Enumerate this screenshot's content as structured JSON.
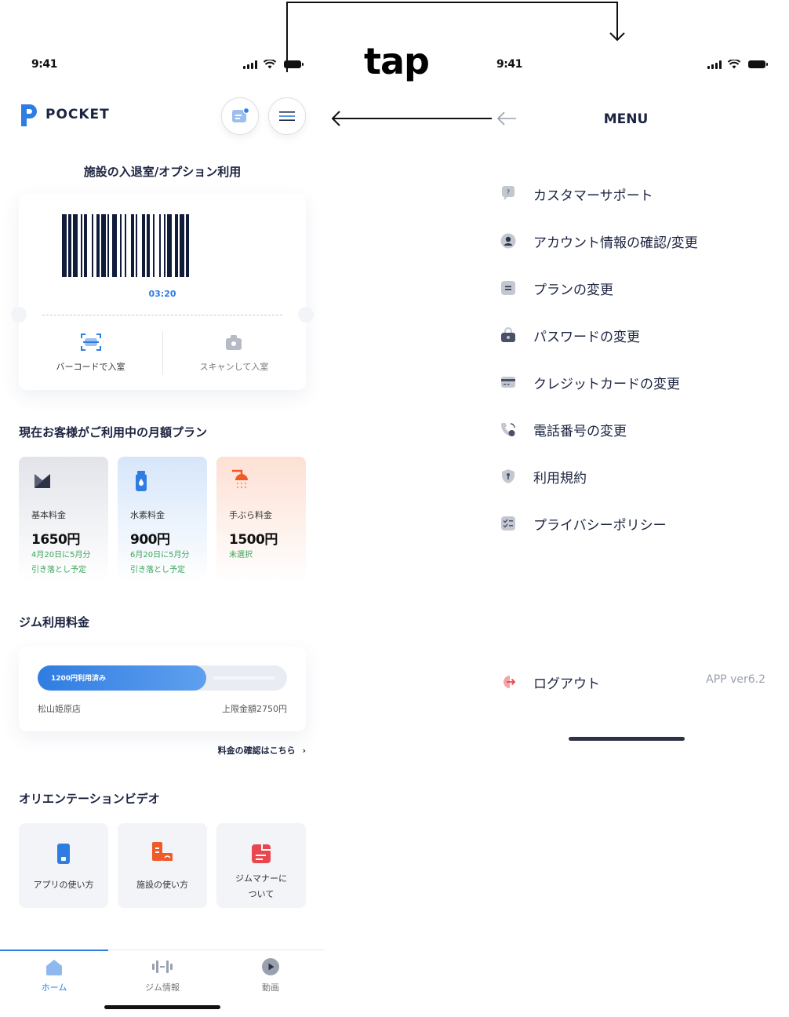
{
  "annotation": {
    "tap_label": "tap"
  },
  "home": {
    "status_time": "9:41",
    "brand": "POCKET",
    "entry_title": "施設の入退室/オプション利用",
    "barcode_timer": "03:20",
    "entry_actions": [
      {
        "label": "バーコードで入室",
        "icon": "barcode-scan-icon"
      },
      {
        "label": "スキャンして入室",
        "icon": "camera-icon"
      }
    ],
    "plans_title": "現在お客様がご利用中の月額プラン",
    "plans": [
      {
        "icon": "basic-plan-icon",
        "label": "基本料金",
        "price": "1650円",
        "note1": "4月20日に5月分",
        "note2": "引き落とし予定"
      },
      {
        "icon": "hydrogen-water-icon",
        "label": "水素料金",
        "price": "900円",
        "note1": "6月20日に5月分",
        "note2": "引き落とし予定"
      },
      {
        "icon": "shower-icon",
        "label": "手ぶら料金",
        "price": "1500円",
        "note1": "未選択",
        "note2": ""
      }
    ],
    "gym_fee_title": "ジム利用料金",
    "gym_fee": {
      "used_label": "1200円利用済み",
      "used_fraction": 0.676,
      "store": "松山姫原店",
      "limit": "上限金額2750円"
    },
    "fee_link": "料金の確認はこちら",
    "video_title": "オリエンテーションビデオ",
    "videos": [
      {
        "icon": "phone-icon",
        "label1": "アプリの使い方",
        "label2": ""
      },
      {
        "icon": "facility-icon",
        "label1": "施設の使い方",
        "label2": ""
      },
      {
        "icon": "manners-icon",
        "label1": "ジムマナーに",
        "label2": "ついて"
      }
    ],
    "nav": [
      {
        "label": "ホーム",
        "icon": "home-icon",
        "active": true
      },
      {
        "label": "ジム情報",
        "icon": "gym-info-icon",
        "active": false
      },
      {
        "label": "動画",
        "icon": "video-icon",
        "active": false
      }
    ]
  },
  "menu": {
    "status_time": "9:41",
    "title": "MENU",
    "items": [
      {
        "label": "カスタマーサポート",
        "icon": "support-icon"
      },
      {
        "label": "アカウント情報の確認/変更",
        "icon": "account-icon"
      },
      {
        "label": "プランの変更",
        "icon": "plan-icon"
      },
      {
        "label": "パスワードの変更",
        "icon": "lock-icon"
      },
      {
        "label": "クレジットカードの変更",
        "icon": "credit-card-icon"
      },
      {
        "label": "電話番号の変更",
        "icon": "phone-call-icon"
      },
      {
        "label": "利用規約",
        "icon": "shield-icon"
      },
      {
        "label": "プライバシーポリシー",
        "icon": "checklist-icon"
      }
    ],
    "logout_label": "ログアウト",
    "version": "APP ver6.2"
  },
  "colors": {
    "navy": "#1b2340",
    "accent_blue": "#2f7de1",
    "green": "#3aa65a",
    "orange": "#f05a28",
    "red": "#e8474f"
  }
}
